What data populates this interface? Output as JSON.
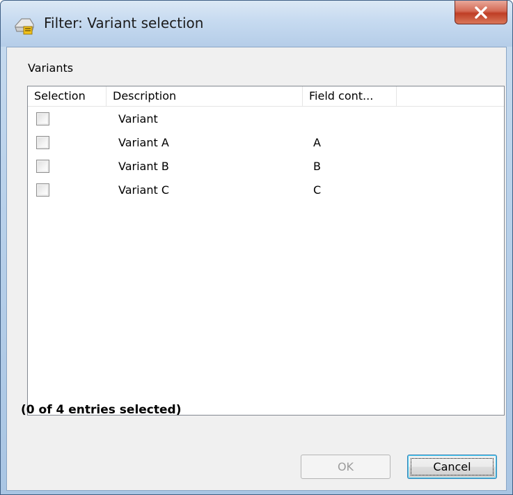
{
  "window": {
    "title": "Filter: Variant selection",
    "title_icon": "filter-icon",
    "close_icon": "close-icon"
  },
  "section": {
    "label": "Variants"
  },
  "list": {
    "columns": [
      "Selection",
      "Description",
      "Field cont..."
    ],
    "rows": [
      {
        "selected": false,
        "description": "Variant",
        "field": ""
      },
      {
        "selected": false,
        "description": "Variant A",
        "field": "A"
      },
      {
        "selected": false,
        "description": "Variant B",
        "field": "B"
      },
      {
        "selected": false,
        "description": "Variant C",
        "field": "C"
      }
    ]
  },
  "status": {
    "text": "(0 of 4 entries selected)"
  },
  "buttons": {
    "ok_label": "OK",
    "ok_enabled": false,
    "cancel_label": "Cancel"
  },
  "colors": {
    "close_button": "#c7432b",
    "titlebar": "#c6daf0",
    "dialog_bg": "#f0f0f0"
  }
}
